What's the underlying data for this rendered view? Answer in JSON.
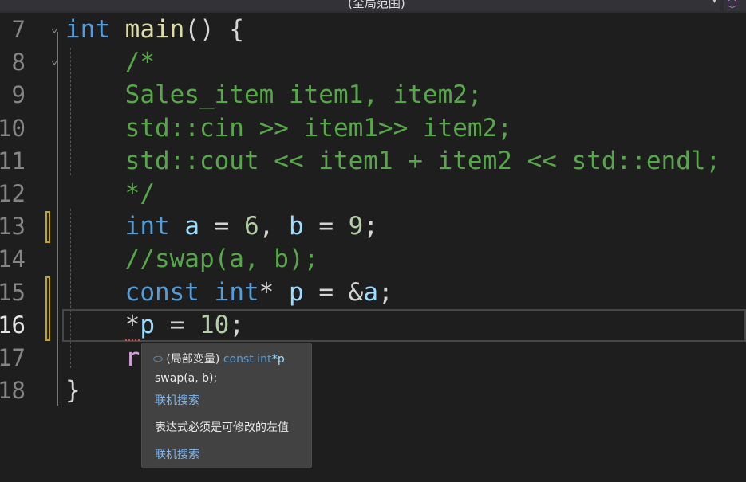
{
  "toolbar": {
    "scope_left": "",
    "scope_middle": "(全局范围)",
    "arrow": "▾"
  },
  "editor": {
    "current_line": 16,
    "lines": [
      {
        "n": "7",
        "tokens": [
          [
            "kw",
            "int"
          ],
          [
            "pn",
            " "
          ],
          [
            "fn",
            "main"
          ],
          [
            "pn",
            "() {"
          ]
        ]
      },
      {
        "n": "8",
        "tokens": [
          [
            "cm",
            "    /*"
          ]
        ]
      },
      {
        "n": "9",
        "tokens": [
          [
            "cm",
            "    Sales_item item1, item2;"
          ]
        ]
      },
      {
        "n": "10",
        "tokens": [
          [
            "cm",
            "    std::cin >> item1>> item2;"
          ]
        ]
      },
      {
        "n": "11",
        "tokens": [
          [
            "cm",
            "    std::cout << item1 + item2 << std::endl;"
          ]
        ]
      },
      {
        "n": "12",
        "tokens": [
          [
            "cm",
            "    */"
          ]
        ]
      },
      {
        "n": "13",
        "tokens": [
          [
            "pn",
            "    "
          ],
          [
            "kw",
            "int"
          ],
          [
            "pn",
            " "
          ],
          [
            "var",
            "a"
          ],
          [
            "pn",
            " = "
          ],
          [
            "num",
            "6"
          ],
          [
            "pn",
            ", "
          ],
          [
            "var",
            "b"
          ],
          [
            "pn",
            " = "
          ],
          [
            "num",
            "9"
          ],
          [
            "pn",
            ";"
          ]
        ]
      },
      {
        "n": "14",
        "tokens": [
          [
            "cm",
            "    //swap(a, b);"
          ]
        ]
      },
      {
        "n": "15",
        "tokens": [
          [
            "pn",
            "    "
          ],
          [
            "kw",
            "const"
          ],
          [
            "pn",
            " "
          ],
          [
            "kw",
            "int"
          ],
          [
            "pn",
            "* "
          ],
          [
            "var",
            "p"
          ],
          [
            "pn",
            " = &"
          ],
          [
            "var",
            "a"
          ],
          [
            "pn",
            ";"
          ]
        ]
      },
      {
        "n": "16",
        "tokens": [
          [
            "pn",
            "    *"
          ],
          [
            "var",
            "p"
          ],
          [
            "pn",
            " = "
          ],
          [
            "num",
            "10"
          ],
          [
            "pn",
            ";"
          ]
        ]
      },
      {
        "n": "17",
        "tokens": [
          [
            "pn",
            "    "
          ],
          [
            "ctl",
            "r"
          ]
        ]
      },
      {
        "n": "18",
        "tokens": [
          [
            "pn",
            "}"
          ]
        ]
      }
    ]
  },
  "tooltip": {
    "kind": "(局部变量)",
    "signature_kw": "const int",
    "signature_rest": " *p",
    "comment": "swap(a, b);",
    "search_link_1": "联机搜索",
    "error": "表达式必须是可修改的左值",
    "search_link_2": "联机搜索"
  }
}
